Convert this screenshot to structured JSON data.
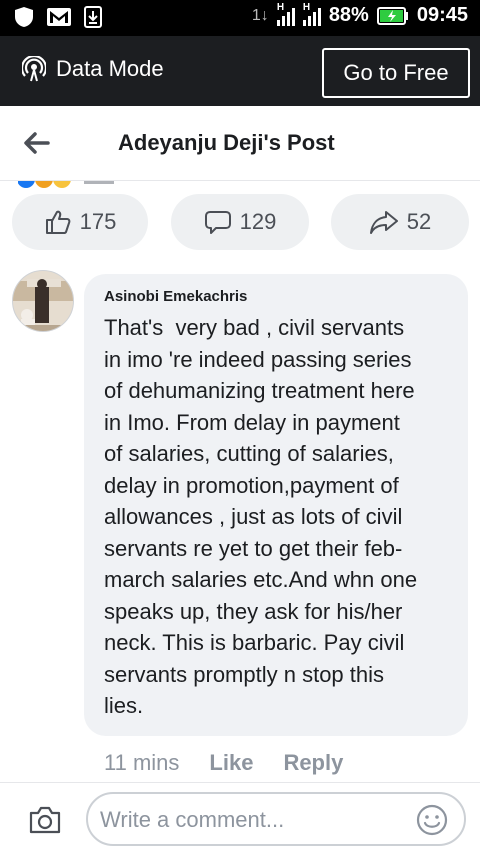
{
  "status_bar": {
    "battery": "88%",
    "time": "09:45",
    "signal_labels": [
      "H",
      "H"
    ],
    "net_indicator": "1↓"
  },
  "data_mode": {
    "label": "Data Mode",
    "go_free_label": "Go to Free"
  },
  "header": {
    "title": "Adeyanju Deji's Post"
  },
  "actions": {
    "likes": "175",
    "comments": "129",
    "shares": "52"
  },
  "comment": {
    "author": "Asinobi Emekachris",
    "text": "That's  very bad , civil servants\nin imo 're indeed passing series\nof dehumanizing treatment here\nin Imo. From delay in payment\nof salaries, cutting of salaries,\ndelay in promotion,payment of\nallowances , just as lots of civil\nservants re yet to get their feb-\nmarch salaries etc.And whn one\nspeaks up, they ask for his/her\nneck. This is barbaric. Pay civil\nservants promptly n stop this\nlies.",
    "time": "11 mins",
    "like_label": "Like",
    "reply_label": "Reply"
  },
  "composer": {
    "placeholder": "Write a comment..."
  },
  "colors": {
    "status_bar_bg": "#000000",
    "data_mode_bg": "#1c1e21",
    "bubble_bg": "#f0f2f5",
    "pill_bg": "#eef0f2",
    "battery_green": "#2ecc40"
  }
}
